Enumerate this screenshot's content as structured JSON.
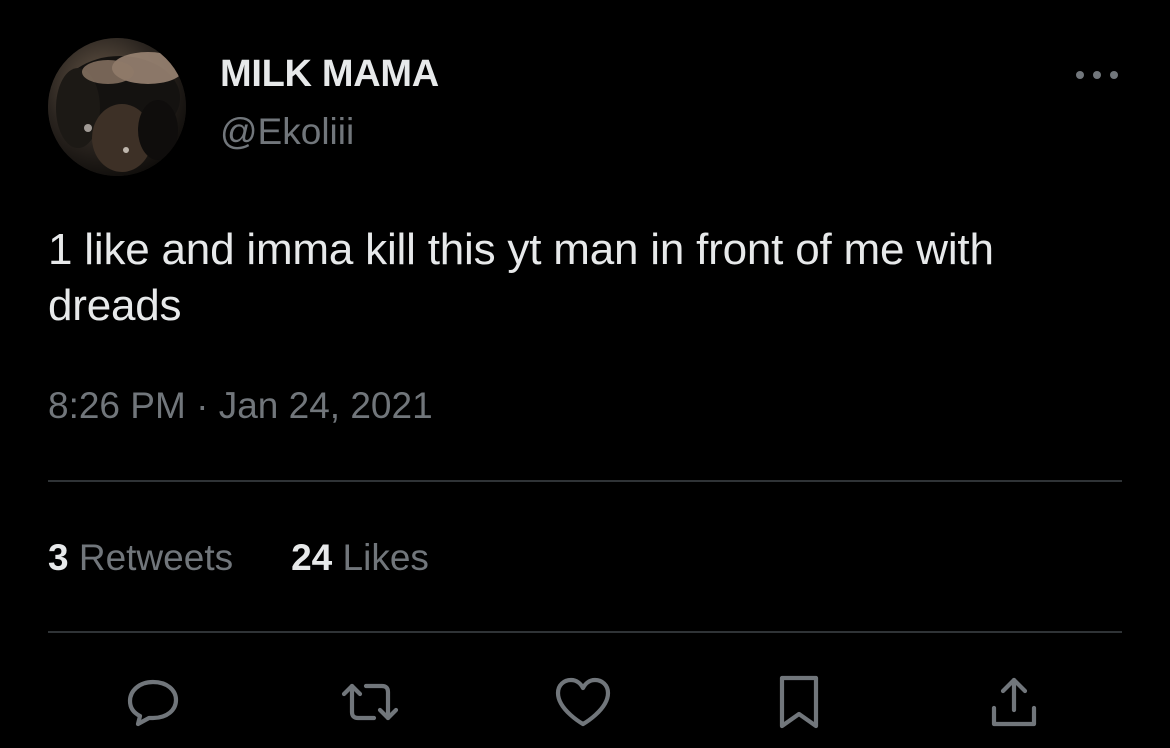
{
  "tweet": {
    "author": {
      "display_name": "MILK MAMA",
      "handle": "@Ekoliii"
    },
    "text": "1 like and imma kill this yt man in front of me with dreads",
    "time": "8:26 PM",
    "separator": "·",
    "date": "Jan 24, 2021",
    "stats": {
      "retweets_count": "3",
      "retweets_label": "Retweets",
      "likes_count": "24",
      "likes_label": "Likes"
    },
    "actions": [
      "reply-icon",
      "retweet-icon",
      "like-icon",
      "bookmark-icon",
      "share-icon"
    ]
  },
  "colors": {
    "background": "#000000",
    "primary_text": "#e7e9ea",
    "secondary_text": "#71767b",
    "divider": "#2f3336"
  }
}
